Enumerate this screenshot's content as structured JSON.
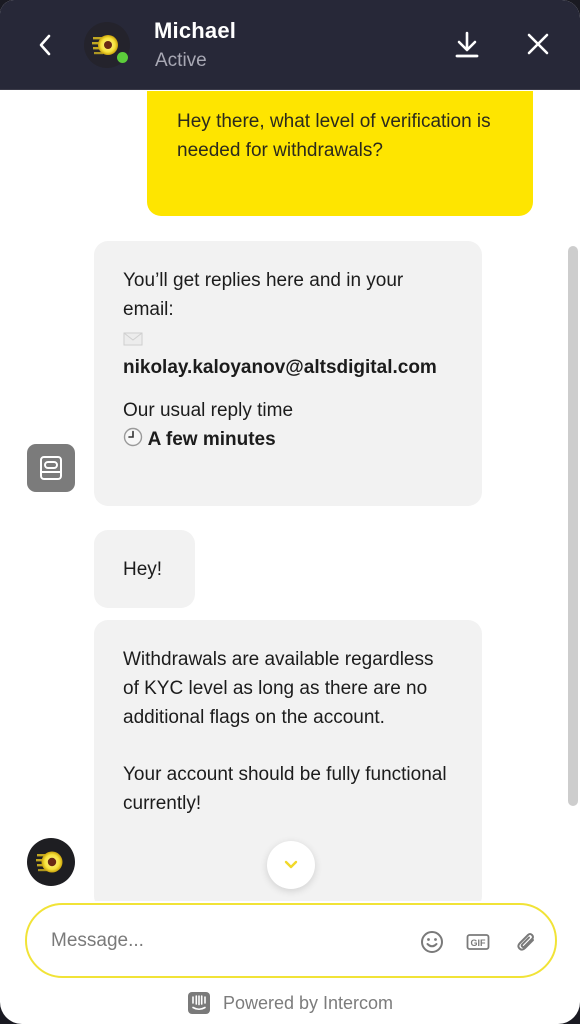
{
  "header": {
    "agent_name": "Michael",
    "agent_status": "Active",
    "online": true,
    "icons": {
      "back": "chevron-left-icon",
      "download": "download-icon",
      "close": "close-icon"
    }
  },
  "colors": {
    "header_bg": "#272838",
    "user_bubble": "#fee500",
    "agent_bubble": "#f2f2f2",
    "accent": "#f1e337",
    "online_dot": "#5ccd3b"
  },
  "messages": [
    {
      "sender": "user",
      "text": "Hey there, what level of verification is needed for withdrawals?"
    },
    {
      "sender": "bot",
      "intro": "You’ll get replies here and in your email:",
      "email_icon": "✉",
      "email": "nikolay.kaloyanov@altsdigital.com",
      "reply_time_label": "Our usual reply time",
      "reply_time_icon": "🕒",
      "reply_time_value": "A few minutes"
    },
    {
      "sender": "agent",
      "text": "Hey!"
    },
    {
      "sender": "agent",
      "paragraphs": [
        "Withdrawals are available regardless of KYC level as long as there are no additional flags on the account.",
        "Your account should be fully functional currently!"
      ]
    }
  ],
  "composer": {
    "placeholder": "Message...",
    "value": "",
    "icons": [
      "emoji-icon",
      "gif-icon",
      "attachment-icon"
    ],
    "gif_label": "GIF"
  },
  "footer": {
    "text": "Powered by Intercom",
    "icon": "intercom-logo-icon"
  }
}
